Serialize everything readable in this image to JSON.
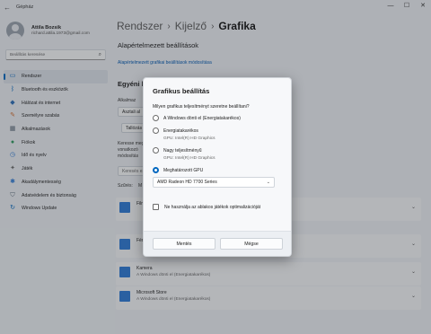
{
  "window": {
    "title": "Gépház",
    "controls": [
      "—",
      "☐",
      "✕"
    ]
  },
  "profile": {
    "name": "Attila Bozsik",
    "email": "richard.attila.1973@gmail.com"
  },
  "search": {
    "placeholder": "Beállítás keresése"
  },
  "nav": [
    {
      "label": "Rendszer",
      "icon": "monitor-icon",
      "color": "#0067c0",
      "active": true
    },
    {
      "label": "Bluetooth és eszközök",
      "icon": "bluetooth-icon",
      "color": "#0067c0"
    },
    {
      "label": "Hálózat és internet",
      "icon": "wifi-icon",
      "color": "#2b6fb8"
    },
    {
      "label": "Személyre szabás",
      "icon": "brush-icon",
      "color": "#d36b2c"
    },
    {
      "label": "Alkalmazások",
      "icon": "apps-icon",
      "color": "#5b6a7a"
    },
    {
      "label": "Fiókok",
      "icon": "person-icon",
      "color": "#2e9b5f"
    },
    {
      "label": "Idő és nyelv",
      "icon": "globe-clock-icon",
      "color": "#2b79d6"
    },
    {
      "label": "Játék",
      "icon": "gamepad-icon",
      "color": "#6b6b6b"
    },
    {
      "label": "Akadálymentesség",
      "icon": "accessibility-icon",
      "color": "#2b79d6"
    },
    {
      "label": "Adatvédelem és biztonság",
      "icon": "shield-icon",
      "color": "#5b6a7a"
    },
    {
      "label": "Windows Update",
      "icon": "update-icon",
      "color": "#0067c0"
    }
  ],
  "breadcrumb": {
    "items": [
      "Rendszer",
      "Kijelző"
    ],
    "current": "Grafika"
  },
  "main": {
    "default_heading": "Alapértelmezett beállítások",
    "default_link": "Alapértelmezett grafikai beállítások módosítása",
    "custom_heading": "Egyéni b",
    "frag_alkalm": "Alkalmaz",
    "frag_asztali": "Asztali al",
    "frag_tallozas": "Tallózás",
    "frag_keresse": "Keresse meg",
    "frag_vonatkozo": "vonatkozó",
    "frag_modositas": "módosítás",
    "frag_kereses": "Keresés ez",
    "frag_szures": "Szűrés:",
    "frag_m": "M"
  },
  "apps": [
    {
      "name": "Film",
      "desc": "",
      "icon": "film-icon"
    },
    {
      "name": "Fén",
      "desc": "",
      "icon": "photos-icon"
    },
    {
      "name": "Kamera",
      "desc": "A Windows dönti el (Energiatakarékos)",
      "icon": "camera-icon"
    },
    {
      "name": "Microsoft Store",
      "desc": "A Windows dönti el (Energiatakarékos)",
      "icon": "store-icon"
    }
  ],
  "dialog": {
    "title": "Grafikus beállítás",
    "question": "Milyen grafikus teljesítményt szeretne beállítani?",
    "options": [
      {
        "label": "A Windows dönti el (Energiatakarékos)",
        "sub": "",
        "checked": false
      },
      {
        "label": "Energiatakarékos",
        "sub": "GPU: Intel(R) HD Graphics",
        "checked": false
      },
      {
        "label": "Nagy teljesítményű",
        "sub": "GPU: Intel(R) HD Graphics",
        "checked": false
      },
      {
        "label": "Meghatározott GPU",
        "sub": "",
        "checked": true
      }
    ],
    "gpu_select": "AMD Radeon HD 7700 Series",
    "checkbox_label": "Ne használja az ablakos játékok optimalizációját",
    "checkbox_checked": false,
    "save_label": "Mentés",
    "cancel_label": "Mégse"
  }
}
